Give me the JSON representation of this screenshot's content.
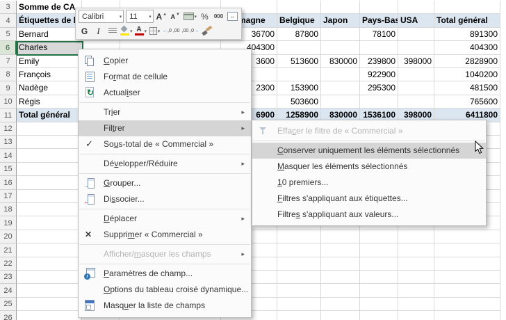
{
  "spreadsheet": {
    "row_numbers": [
      3,
      4,
      5,
      6,
      7,
      8,
      9,
      10,
      11,
      12,
      13,
      14,
      15,
      16,
      17,
      18,
      19,
      20,
      21,
      22,
      23,
      24,
      25,
      26
    ],
    "selected_row": 6,
    "corner_label": "Somme de CA",
    "row_labels_header": "Étiquettes de lignes",
    "column_headers": [
      "Allemagne",
      "Belgique",
      "Japon",
      "Pays-Bas",
      "USA",
      "Total général"
    ],
    "rows": [
      {
        "label": "Bernard",
        "values": [
          "36700",
          "87800",
          "",
          "78100",
          "",
          "891300"
        ]
      },
      {
        "label": "Charles",
        "values": [
          "404300",
          "",
          "",
          "",
          "",
          "404300"
        ]
      },
      {
        "label": "Emily",
        "values": [
          "3600",
          "513600",
          "830000",
          "239800",
          "398000",
          "2828900"
        ]
      },
      {
        "label": "François",
        "values": [
          "",
          "",
          "",
          "922900",
          "",
          "1040200"
        ]
      },
      {
        "label": "Nadège",
        "values": [
          "2300",
          "153900",
          "",
          "295300",
          "",
          "481500"
        ]
      },
      {
        "label": "Régis",
        "values": [
          "",
          "503600",
          "",
          "",
          "",
          "765600"
        ]
      }
    ],
    "total_row": {
      "label": "Total général",
      "values": [
        "6900",
        "1258900",
        "830000",
        "1536100",
        "398000",
        "6411800"
      ]
    }
  },
  "mini_toolbar": {
    "font_name": "Calibri",
    "font_size": "11",
    "bold_label": "G",
    "italic_label": "I",
    "percent_label": "%",
    "thousands_label": "000",
    "increase_decimal_label": ",0 ,00",
    "decrease_decimal_label": ",00 ,0"
  },
  "context_menu": {
    "items": [
      {
        "type": "item",
        "name": "menu-item-copier",
        "icon": "copy-icon",
        "html": "<u>C</u>opier"
      },
      {
        "type": "item",
        "name": "menu-item-format-de-cellule",
        "icon": "cell-format-icon",
        "html": "Fo<u>r</u>mat de cellule"
      },
      {
        "type": "item",
        "name": "menu-item-actualiser",
        "icon": "refresh-icon",
        "html": "Actual<u>i</u>ser"
      },
      {
        "type": "separator"
      },
      {
        "type": "item",
        "name": "menu-item-trier",
        "html": "Tr<u>i</u>er",
        "submenu": true
      },
      {
        "type": "item",
        "name": "menu-item-filtrer",
        "html": "Fil<u>t</u>rer",
        "submenu": true,
        "highlighted": true
      },
      {
        "type": "item",
        "name": "menu-item-sous-total",
        "icon": "check-icon",
        "html": "So<u>u</u>s-total de « Commercial »"
      },
      {
        "type": "separator"
      },
      {
        "type": "item",
        "name": "menu-item-developper-reduire",
        "html": "Dé<u>v</u>elopper/Réduire",
        "submenu": true
      },
      {
        "type": "separator"
      },
      {
        "type": "item",
        "name": "menu-item-grouper",
        "icon": "group-icon",
        "html": "<u>G</u>rouper..."
      },
      {
        "type": "item",
        "name": "menu-item-dissocier",
        "icon": "ungroup-icon",
        "html": "Di<u>s</u>socier..."
      },
      {
        "type": "separator"
      },
      {
        "type": "item",
        "name": "menu-item-deplacer",
        "html": "<u>D</u>éplacer",
        "submenu": true
      },
      {
        "type": "item",
        "name": "menu-item-supprimer",
        "icon": "delete-icon",
        "html": "Suppri<u>m</u>er « Commercial »"
      },
      {
        "type": "separator"
      },
      {
        "type": "item",
        "name": "menu-item-afficher-masquer-champs",
        "html": "Afficher/<u>m</u>asquer les champs",
        "submenu": true,
        "disabled": true
      },
      {
        "type": "separator"
      },
      {
        "type": "item",
        "name": "menu-item-parametres-de-champ",
        "icon": "field-settings-icon",
        "html": "<u>P</u>aramètres de champ..."
      },
      {
        "type": "item",
        "name": "menu-item-options-tcd",
        "html": "<u>O</u>ptions du tableau croisé dynamique..."
      },
      {
        "type": "item",
        "name": "menu-item-masquer-liste-champs",
        "icon": "field-list-icon",
        "html": "Masq<u>u</u>er la liste de champs"
      }
    ]
  },
  "filter_submenu": {
    "items": [
      {
        "type": "item",
        "name": "submenu-item-effacer-filtre",
        "icon": "clear-filter-icon",
        "html": "Effa<u>c</u>er le filtre de « Commercial »",
        "disabled": true
      },
      {
        "type": "separator"
      },
      {
        "type": "item",
        "name": "submenu-item-conserver-elements",
        "html": "<u>C</u>onserver uniquement les éléments sélectionnés",
        "highlighted": true
      },
      {
        "type": "item",
        "name": "submenu-item-masquer-elements",
        "html": "<u>M</u>asquer les éléments sélectionnés"
      },
      {
        "type": "item",
        "name": "submenu-item-10-premiers",
        "html": "<u>1</u>0 premiers..."
      },
      {
        "type": "item",
        "name": "submenu-item-filtres-etiquettes",
        "html": "<u>F</u>iltres s'appliquant aux étiquettes..."
      },
      {
        "type": "item",
        "name": "submenu-item-filtres-valeurs",
        "html": "Filtre<u>s</u> s'appliquant aux valeurs..."
      }
    ]
  }
}
